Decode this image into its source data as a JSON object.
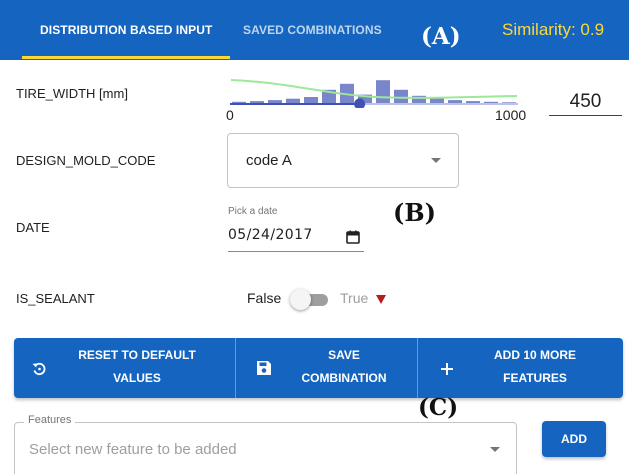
{
  "tabs": {
    "distribution": "DISTRIBUTION BASED INPUT",
    "saved": "SAVED COMBINATIONS"
  },
  "annotations": {
    "a": "(A)",
    "b": "(B)",
    "c": "(C)"
  },
  "similarity": "Similarity: 0.9",
  "fields": {
    "tire_width": {
      "label": "TIRE_WIDTH [mm]",
      "min": "0",
      "max": "1000",
      "value": "450",
      "slider_fraction": 0.45,
      "histogram": [
        0.05,
        0.08,
        0.12,
        0.18,
        0.25,
        0.55,
        0.8,
        0.35,
        0.95,
        0.55,
        0.3,
        0.2,
        0.12,
        0.08,
        0.05,
        0.03
      ]
    },
    "design_mold_code": {
      "label": "DESIGN_MOLD_CODE",
      "value": "code A"
    },
    "date": {
      "label": "DATE",
      "caption": "Pick a date",
      "value": "05/24/2017"
    },
    "is_sealant": {
      "label": "IS_SEALANT",
      "off_label": "False",
      "on_label": "True",
      "checked": false
    }
  },
  "actions": {
    "reset_line1": "RESET TO DEFAULT",
    "reset_line2": "VALUES",
    "save_line1": "SAVE",
    "save_line2": "COMBINATION",
    "add10_line1": "ADD 10 MORE",
    "add10_line2": "FEATURES"
  },
  "features": {
    "legend": "Features",
    "placeholder": "Select new feature to be added",
    "add_label": "ADD"
  },
  "icons": {
    "reset": "restore-icon",
    "save": "floppy-icon",
    "add": "plus-icon",
    "calendar": "calendar-icon"
  },
  "colors": {
    "primary": "#1565c0",
    "accent": "#fdd835",
    "histogram": "#7986cb",
    "density": "#9ee89a",
    "alert": "#b71c1c"
  }
}
